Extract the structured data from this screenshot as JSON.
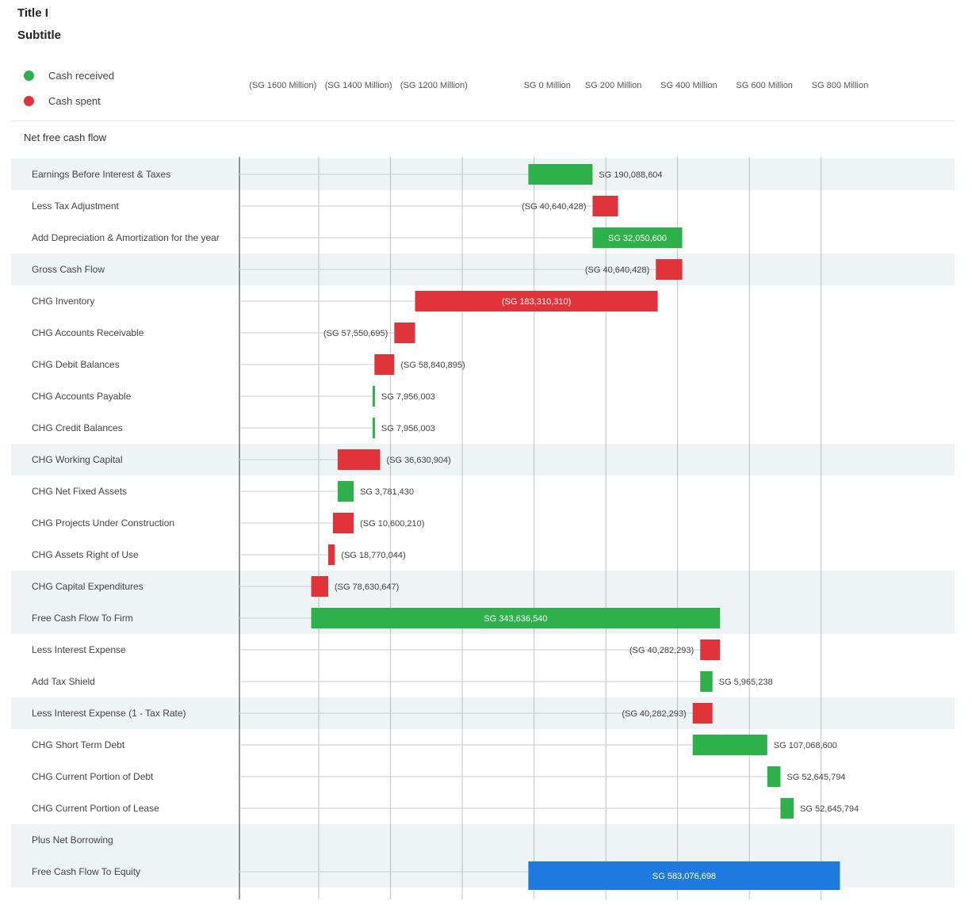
{
  "title": "Title I",
  "subtitle": "Subtitle",
  "legend": [
    {
      "label": "Cash received",
      "color": "#2eb04b"
    },
    {
      "label": "Cash spent",
      "color": "#e0343a"
    }
  ],
  "section_heading": "Net free cash flow",
  "chart_data": {
    "type": "waterfall",
    "title": "Title I",
    "subtitle": "Subtitle",
    "units": "Millions",
    "x_min": -3.06,
    "x_max": 4.48,
    "axis_ticks": [
      {
        "value": -2.6,
        "label": "(SG 1600 Million)"
      },
      {
        "value": -1.8,
        "label": "(SG 1400 Million)"
      },
      {
        "value": -1.0,
        "label": "(SG 1200 Million)"
      },
      {
        "value": 0.2,
        "label": "SG 0 Million"
      },
      {
        "value": 0.9,
        "label": "SG 200 Million"
      },
      {
        "value": 1.7,
        "label": "SG 400 Million"
      },
      {
        "value": 2.5,
        "label": "SG 600 Million"
      },
      {
        "value": 3.3,
        "label": "SG 800 Million"
      }
    ],
    "gridlines": [
      -2.22,
      -1.46,
      -0.7,
      0.06,
      0.82,
      1.58,
      2.34,
      3.1
    ],
    "rows": [
      {
        "label": "Earnings Before Interest & Taxes",
        "start": 0.0,
        "end": 0.68,
        "type": "pos",
        "highlight": true,
        "value_label": "SG 190,088,604",
        "label_pos": "right"
      },
      {
        "label": "Less Tax Adjustment",
        "start": 0.68,
        "end": 0.95,
        "type": "neg",
        "highlight": false,
        "value_label": "(SG 40,640,428)",
        "label_pos": "left"
      },
      {
        "label": "Add Depreciation & Amortization for the year",
        "start": 0.68,
        "end": 1.63,
        "type": "pos",
        "highlight": false,
        "value_label": "SG 32,050,600",
        "label_pos": "inside"
      },
      {
        "label": "Gross Cash Flow",
        "start": 1.35,
        "end": 1.63,
        "type": "neg",
        "highlight": true,
        "value_label": "(SG 40,640,428)",
        "label_pos": "left"
      },
      {
        "label": "CHG Inventory",
        "start": -1.2,
        "end": 1.37,
        "type": "neg",
        "highlight": false,
        "value_label": "(SG 183,310,310)",
        "label_pos": "inside"
      },
      {
        "label": "CHG Accounts Receivable",
        "start": -1.42,
        "end": -1.2,
        "type": "neg",
        "highlight": false,
        "value_label": "(SG 57,550,695)",
        "label_pos": "left"
      },
      {
        "label": "CHG Debit Balances",
        "start": -1.63,
        "end": -1.42,
        "type": "neg",
        "highlight": false,
        "value_label": "(SG 58,840,895)",
        "label_pos": "right"
      },
      {
        "label": "CHG Accounts Payable",
        "start": -1.65,
        "end": -1.63,
        "type": "pos",
        "highlight": false,
        "value_label": "SG 7,956,003",
        "label_pos": "right"
      },
      {
        "label": "CHG Credit Balances",
        "start": -1.65,
        "end": -1.63,
        "type": "pos",
        "highlight": false,
        "value_label": "SG 7,956,003",
        "label_pos": "right"
      },
      {
        "label": "CHG Working Capital",
        "start": -2.02,
        "end": -1.57,
        "type": "neg",
        "highlight": true,
        "value_label": "(SG 36,630,904)",
        "label_pos": "right"
      },
      {
        "label": "CHG Net Fixed Assets",
        "start": -2.02,
        "end": -1.85,
        "type": "pos",
        "highlight": false,
        "value_label": "SG 3,781,430",
        "label_pos": "right"
      },
      {
        "label": "CHG Projects Under Construction",
        "start": -2.07,
        "end": -1.85,
        "type": "neg",
        "highlight": false,
        "value_label": "(SG 10,600,210)",
        "label_pos": "right"
      },
      {
        "label": "CHG Assets Right of Use",
        "start": -2.12,
        "end": -2.05,
        "type": "neg",
        "highlight": false,
        "value_label": "(SG 18,770,044)",
        "label_pos": "right"
      },
      {
        "label": "CHG Capital Expenditures",
        "start": -2.3,
        "end": -2.12,
        "type": "neg",
        "highlight": true,
        "value_label": "(SG 78,630,647)",
        "label_pos": "right"
      },
      {
        "label": "Free Cash Flow To Firm",
        "start": -2.3,
        "end": 2.03,
        "type": "pos",
        "highlight": true,
        "value_label": "SG 343,636,540",
        "label_pos": "inside"
      },
      {
        "label": "Less Interest Expense",
        "start": 1.82,
        "end": 2.03,
        "type": "neg",
        "highlight": false,
        "value_label": "(SG 40,282,293)",
        "label_pos": "left"
      },
      {
        "label": "Add Tax Shield",
        "start": 1.82,
        "end": 1.95,
        "type": "pos",
        "highlight": false,
        "value_label": "SG 5,965,238",
        "label_pos": "right"
      },
      {
        "label": "Less Interest Expense (1 - Tax Rate)",
        "start": 1.74,
        "end": 1.95,
        "type": "neg",
        "highlight": true,
        "value_label": "(SG 40,282,293)",
        "label_pos": "left"
      },
      {
        "label": "CHG Short Term Debt",
        "start": 1.74,
        "end": 2.53,
        "type": "pos",
        "highlight": false,
        "value_label": "SG 107,068,600",
        "label_pos": "right"
      },
      {
        "label": "CHG Current Portion of Debt",
        "start": 2.53,
        "end": 2.67,
        "type": "pos",
        "highlight": false,
        "value_label": "SG 52,645,794",
        "label_pos": "right"
      },
      {
        "label": "CHG Current Portion of Lease",
        "start": 2.67,
        "end": 2.81,
        "type": "pos",
        "highlight": false,
        "value_label": "SG 52,645,794",
        "label_pos": "right"
      },
      {
        "label": "Plus Net Borrowing",
        "start": null,
        "end": null,
        "type": "none",
        "highlight": true,
        "value_label": "",
        "label_pos": "none"
      },
      {
        "label": "Free Cash Flow To Equity",
        "start": 0.0,
        "end": 3.3,
        "type": "total",
        "highlight": true,
        "value_label": "SG 583,076,698",
        "label_pos": "inside"
      }
    ]
  },
  "colors": {
    "positive": "#2eb04b",
    "negative": "#e0343a",
    "total": "#1f7ae0",
    "highlight_row": "#eef3f6",
    "gridline": "#9a9a9a",
    "leader": "#cfcfcf"
  }
}
